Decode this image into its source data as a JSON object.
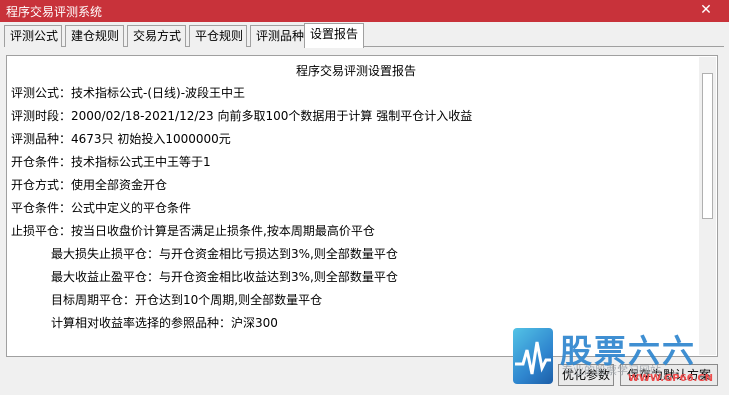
{
  "window": {
    "title": "程序交易评测系统",
    "close_glyph": "✕",
    "title_bar_color": "#c8323a"
  },
  "tabs": [
    {
      "label": "评测公式"
    },
    {
      "label": "建仓规则"
    },
    {
      "label": "交易方式"
    },
    {
      "label": "平仓规则"
    },
    {
      "label": "评测品种"
    },
    {
      "label": "设置报告",
      "active": true
    }
  ],
  "report": {
    "title": "程序交易评测设置报告",
    "lines": [
      "评测公式：技术指标公式-(日线)-波段王中王",
      "评测时段：2000/02/18-2021/12/23 向前多取100个数据用于计算 强制平仓计入收益",
      "评测品种：4673只 初始投入1000000元",
      "开仓条件：技术指标公式王中王等于1",
      "开仓方式：使用全部资金开仓",
      "平仓条件：公式中定义的平仓条件",
      "止损平仓：按当日收盘价计算是否满足止损条件,按本周期最高价平仓",
      "最大损失止损平仓：与开仓资金相比亏损达到3%,则全部数量平仓",
      "最大收益止盈平仓：与开仓资金相比收益达到3%,则全部数量平仓",
      "目标周期平仓：开仓达到10个周期,则全部数量平仓",
      "计算相对收益率选择的参照品种：沪深300"
    ]
  },
  "buttons": {
    "optimize": "优化参数",
    "save_default": "保存为默认方案"
  },
  "watermark": {
    "brand": "股票六六",
    "slogan": "专业的股票学习网站",
    "url": "WWW.GP66.CN",
    "brand_color": "#2f86cf",
    "url_color": "#ef4b4b"
  }
}
